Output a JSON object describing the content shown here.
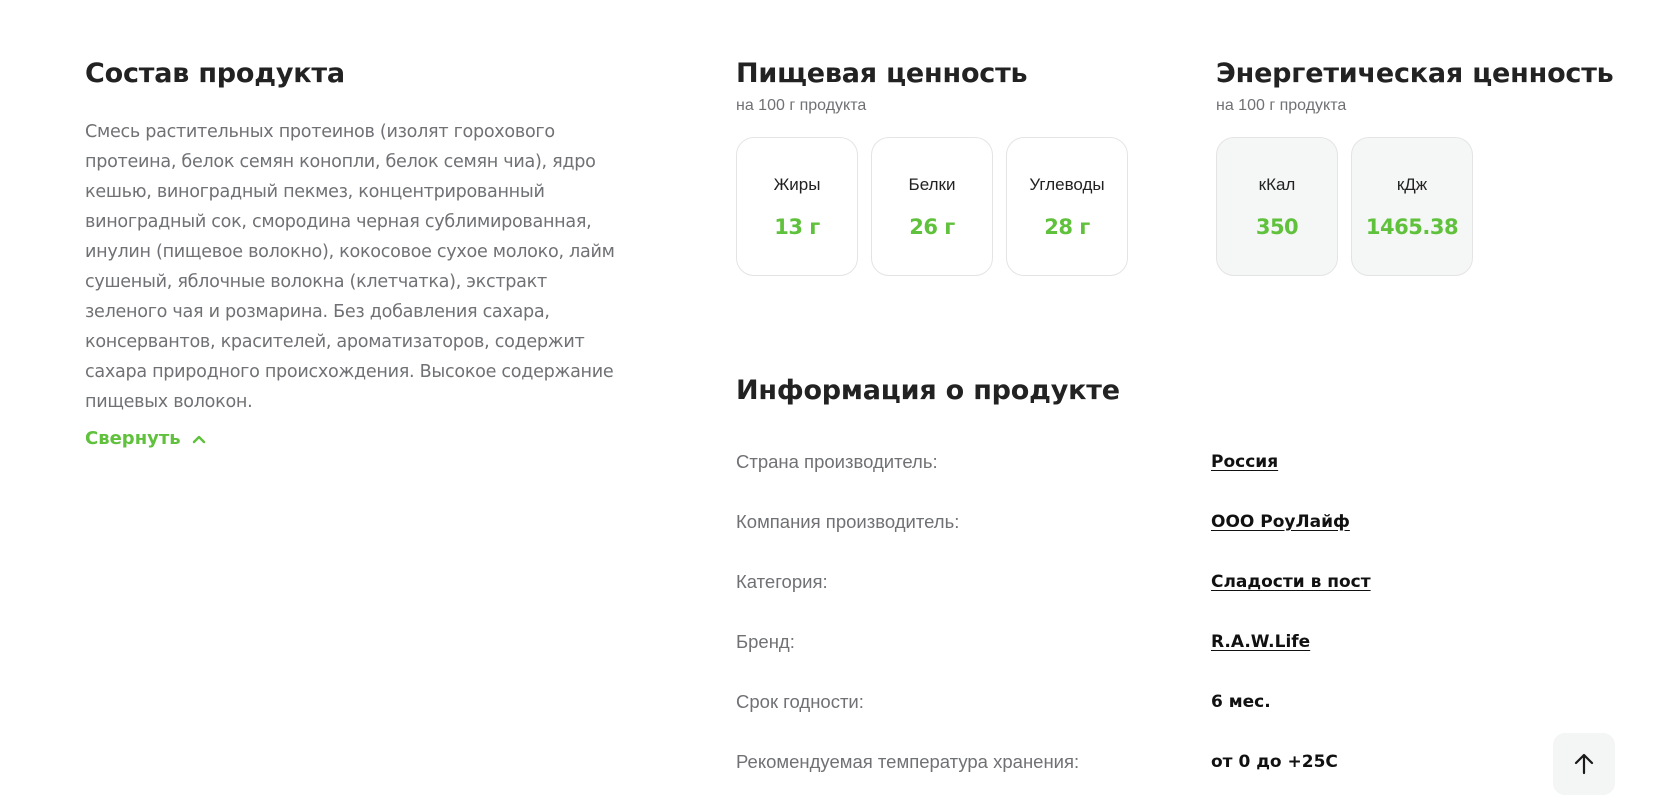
{
  "composition": {
    "title": "Состав продукта",
    "text": "Смесь растительных протеинов (изолят горохового протеина, белок семян конопли, белок семян чиа), ядро кешью, виноградный пекмез, концентрированный виноградный сок, смородина черная сублимированная, инулин (пищевое волокно), кокосовое сухое молоко, лайм сушеный, яблочные волокна (клетчатка), экстракт зеленого чая и розмарина. Без добавления сахара, консервантов, красителей, ароматизаторов, содержит сахара природного происхождения. Высокое содержание пищевых волокон.",
    "collapse_label": "Свернуть"
  },
  "nutrition": {
    "title": "Пищевая ценность",
    "subtitle": "на 100 г продукта",
    "items": [
      {
        "label": "Жиры",
        "value": "13 г"
      },
      {
        "label": "Белки",
        "value": "26 г"
      },
      {
        "label": "Углеводы",
        "value": "28 г"
      }
    ]
  },
  "energy": {
    "title": "Энергетическая ценность",
    "subtitle": "на 100 г продукта",
    "items": [
      {
        "label": "кКал",
        "value": "350"
      },
      {
        "label": "кДж",
        "value": "1465.38"
      }
    ]
  },
  "product_info": {
    "title": "Информация о продукте",
    "rows": [
      {
        "key": "Страна производитель:",
        "value": "Россия"
      },
      {
        "key": "Компания производитель:",
        "value": "ООО РоуЛайф"
      },
      {
        "key": "Категория:",
        "value": "Сладости в пост"
      },
      {
        "key": "Бренд:",
        "value": "R.A.W.Life"
      },
      {
        "key": "Срок годности:",
        "value": "6 мес."
      },
      {
        "key": "Рекомендуемая температура хранения:",
        "value": "от 0 до +25C"
      }
    ]
  },
  "colors": {
    "accent": "#5fc13c",
    "text_muted": "#6f7174",
    "heading": "#222222"
  },
  "icons": {
    "collapse": "chevron-up-icon",
    "scroll_top": "arrow-up-icon"
  }
}
